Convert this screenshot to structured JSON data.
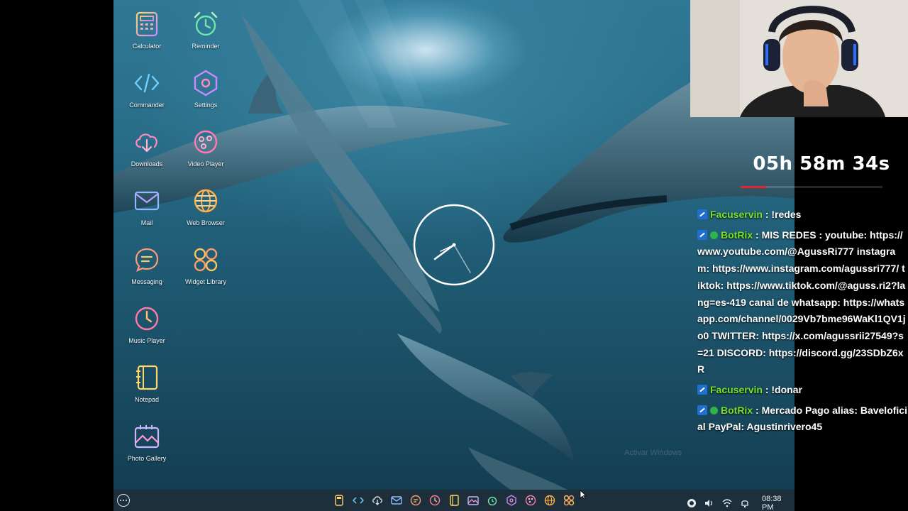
{
  "desktop": {
    "apps_col1": [
      {
        "label": "Calculator",
        "icon": "calculator-icon"
      },
      {
        "label": "Commander",
        "icon": "code-icon"
      },
      {
        "label": "Downloads",
        "icon": "cloud-download-icon"
      },
      {
        "label": "Mail",
        "icon": "mail-icon"
      },
      {
        "label": "Messaging",
        "icon": "chat-bubble-icon"
      },
      {
        "label": "Music Player",
        "icon": "music-player-icon"
      },
      {
        "label": "Notepad",
        "icon": "notepad-icon"
      },
      {
        "label": "Photo Gallery",
        "icon": "photo-gallery-icon"
      }
    ],
    "apps_col2": [
      {
        "label": "Reminder",
        "icon": "alarm-clock-icon"
      },
      {
        "label": "Settings",
        "icon": "hexagon-settings-icon"
      },
      {
        "label": "Video Player",
        "icon": "video-player-icon"
      },
      {
        "label": "Web Browser",
        "icon": "globe-icon"
      },
      {
        "label": "Widget Library",
        "icon": "widget-grid-icon"
      }
    ]
  },
  "taskbar": {
    "time": "08:38 PM",
    "watermark": "Activar Windows"
  },
  "stream": {
    "timer": "05h 58m 34s",
    "timer_progress": 0.18,
    "chat": [
      {
        "user": "Facuservin",
        "text": " : !redes",
        "verified": false
      },
      {
        "user": "BotRix",
        "text": " : MIS REDES : youtube: https://www.youtube.com/@AgussRi777 instagram: https://www.instagram.com/agussri777/ tiktok: https://www.tiktok.com/@aguss.ri2?lang=es-419 canal de whatsapp: https://whatsapp.com/channel/0029Vb7bme96WaKl1QV1jo0 TWITTER: https://x.com/agussrii27549?s=21 DISCORD: https://discord.gg/23SDbZ6xR",
        "verified": true
      },
      {
        "user": "Facuservin",
        "text": " : !donar",
        "verified": false
      },
      {
        "user": "BotRix",
        "text": " : Mercado Pago alias: Baveloficial PayPal: Agustinrivero45",
        "verified": true
      }
    ]
  },
  "colors": {
    "accent_timer": "#e0262e",
    "chat_user": "#79e02a",
    "taskbar": "#1c2f3b"
  }
}
